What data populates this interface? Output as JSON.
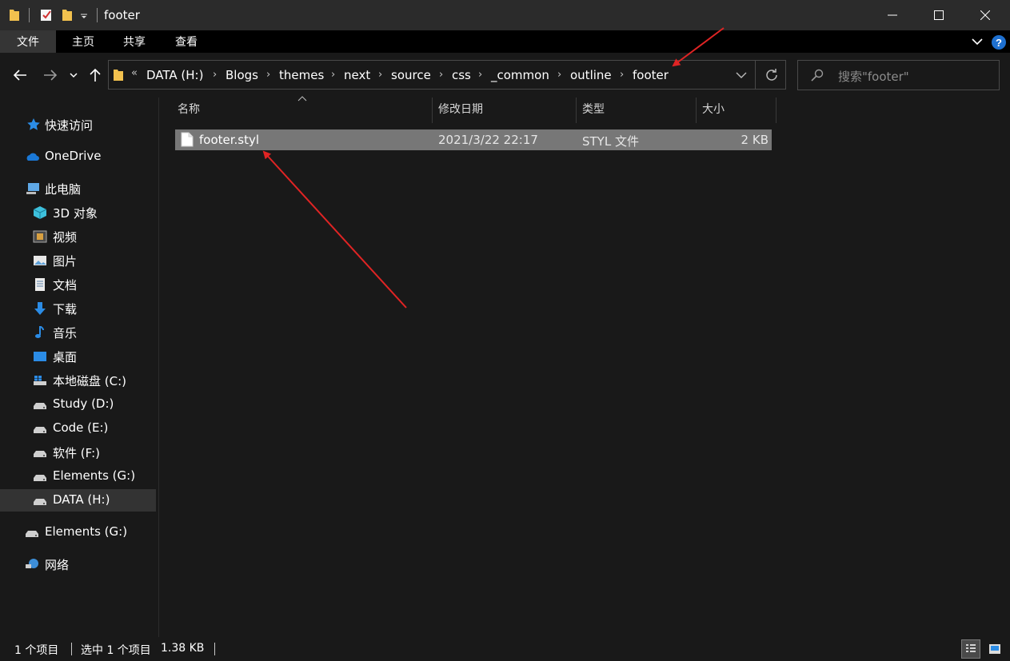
{
  "window": {
    "title": "footer"
  },
  "ribbon": {
    "tabs": [
      "文件",
      "主页",
      "共享",
      "查看"
    ]
  },
  "breadcrumb": {
    "overflow": "«",
    "items": [
      "DATA (H:)",
      "Blogs",
      "themes",
      "next",
      "source",
      "css",
      "_common",
      "outline",
      "footer"
    ]
  },
  "search": {
    "placeholder": "搜索\"footer\""
  },
  "sidebar": {
    "items": [
      "快速访问",
      "OneDrive",
      "此电脑",
      "3D 对象",
      "视频",
      "图片",
      "文档",
      "下载",
      "音乐",
      "桌面",
      "本地磁盘 (C:)",
      "Study (D:)",
      "Code (E:)",
      "软件 (F:)",
      "Elements (G:)",
      "DATA (H:)",
      "Elements (G:)",
      "网络"
    ]
  },
  "columns": {
    "name": "名称",
    "modified": "修改日期",
    "type": "类型",
    "size": "大小"
  },
  "files": [
    {
      "name": "footer.styl",
      "modified": "2021/3/22 22:17",
      "type": "STYL 文件",
      "size": "2 KB"
    }
  ],
  "status": {
    "count": "1 个项目",
    "selected": "选中 1 个项目",
    "selected_size": "1.38 KB"
  },
  "colors": {
    "background": "#191919",
    "titlebar": "#2b2b2b",
    "selection": "#777777",
    "accent_blue": "#1e90ff",
    "arrow_red": "#e02424"
  }
}
